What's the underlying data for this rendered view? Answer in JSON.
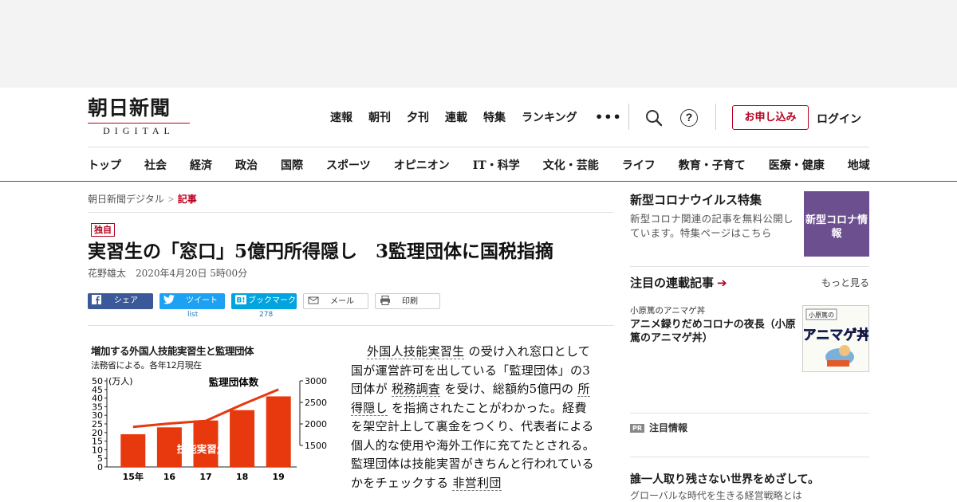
{
  "logo": {
    "kanji": "朝日新聞",
    "sub": "DIGITAL"
  },
  "topnav": [
    "速報",
    "朝刊",
    "夕刊",
    "連載",
    "特集",
    "ランキング"
  ],
  "header": {
    "more": "•••",
    "help": "?",
    "subscribe": "お申し込み",
    "login": "ログイン"
  },
  "categories": [
    "トップ",
    "社会",
    "経済",
    "政治",
    "国際",
    "スポーツ",
    "オピニオン",
    "IT・科学",
    "文化・芸能",
    "ライフ",
    "教育・子育て",
    "医療・健康",
    "地域"
  ],
  "breadcrumb": {
    "home": "朝日新聞デジタル",
    "sep": ">",
    "current": "記事"
  },
  "article": {
    "badge": "独自",
    "title": "実習生の「窓口」5億円所得隠し　3監理団体に国税指摘",
    "author": "花野雄太",
    "date": "2020年4月20日 5時00分",
    "share": {
      "facebook": "シェア",
      "twitter": "ツイート",
      "hatena": "ブックマーク",
      "mail": "メール",
      "print": "印刷",
      "twitter_count": "list",
      "hatena_count": "278"
    },
    "body": [
      "外国人技能実習生",
      "の受け入れ窓口として国が運営許可を出している「監理団体」の3団体が",
      "税務調査",
      "を受け、総額約5億円の",
      "所得隠し",
      "を指摘されたことがわかった。経費を架空計上して裏金をつくり、代表者による個人的な使用や海外工作に充てたとされる。監理団体は技能実習がきちんと行われているかをチェックする",
      "非営利団"
    ]
  },
  "chart_data": {
    "type": "bar",
    "title": "増加する外国人技能実習生と監理団体",
    "note": "法務省による。各年12月現在",
    "categories": [
      "15年",
      "16",
      "17",
      "18",
      "19"
    ],
    "left_axis_label": "(万人)",
    "right_axis_ticks": [
      "3000",
      "2500",
      "2000",
      "1500"
    ],
    "left_axis_ticks": [
      "50",
      "45",
      "40",
      "35",
      "30",
      "25",
      "20",
      "15",
      "10",
      "5",
      "0"
    ],
    "ylim": [
      0,
      50
    ],
    "y2lim": [
      1000,
      3000
    ],
    "series": [
      {
        "name": "技能実習生",
        "kind": "bar",
        "axis": "left",
        "values": [
          19,
          23,
          27,
          33,
          41
        ],
        "color": "#e8380d"
      },
      {
        "name": "監理団体数",
        "kind": "line",
        "axis": "right",
        "values": [
          1930,
          2010,
          2070,
          2450,
          2800
        ],
        "color": "#e8380d"
      }
    ]
  },
  "sidebar": {
    "corona_title": "新型コロナウイルス特集",
    "corona_desc": "新型コロナ関連の記事を無料公開しています。特集ページはこちら",
    "corona_box": "新型コロナ情報",
    "series_title": "注目の連載記事",
    "series_arrow": "➔",
    "more": "もっと見る",
    "series_label": "小原篤のアニマゲ丼",
    "series_text": "アニメ録りだめコロナの夜長（小原篤のアニマゲ丼）",
    "series_img_text": "小原篤の",
    "series_img_big": "アニマゲ丼",
    "pr_tag": "PR",
    "pr_label": "注目情報",
    "ad_title": "誰一人取り残さない世界をめざして。",
    "ad_sub": "グローバルな時代を生きる経営戦略とは"
  },
  "colors": {
    "brand": "#b8001f",
    "facebook": "#3b5998",
    "twitter": "#1da1f2",
    "hatena": "#00a4de",
    "corona": "#6b4f8e",
    "chart": "#e8380d"
  }
}
